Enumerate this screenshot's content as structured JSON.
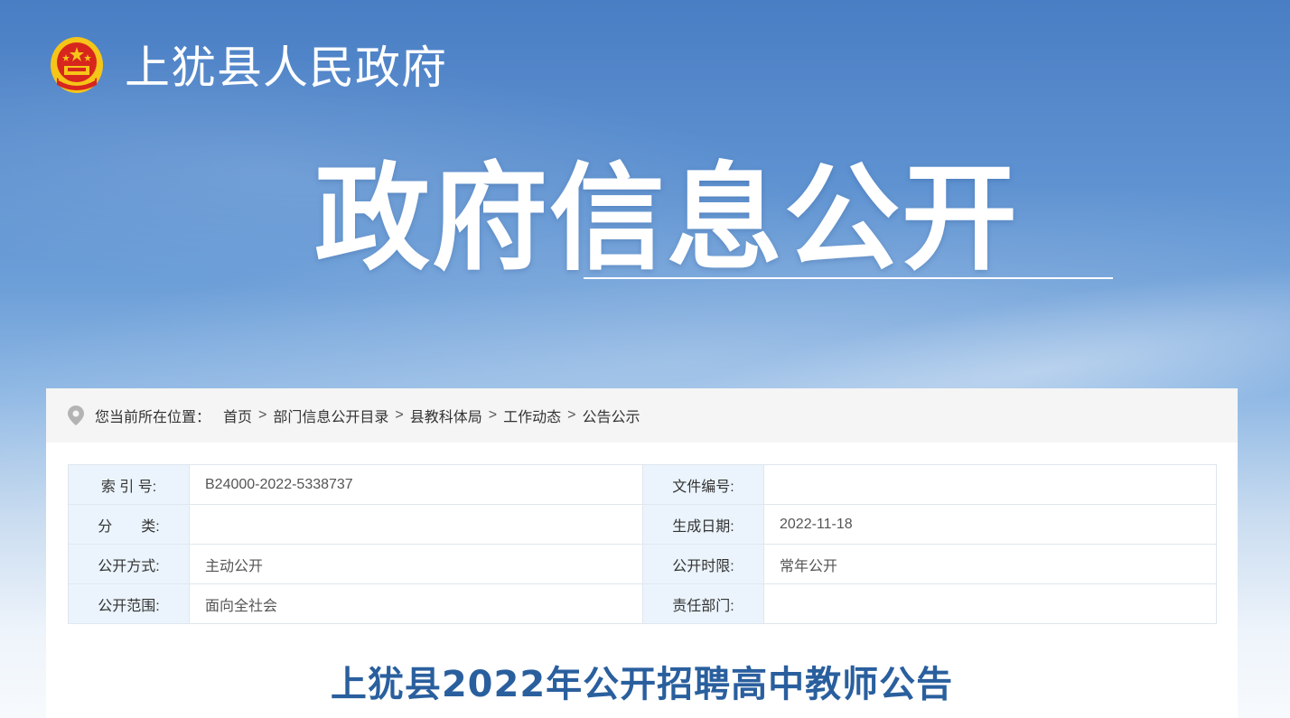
{
  "header": {
    "site_title": "上犹县人民政府",
    "logo_icon": "national-emblem-icon"
  },
  "banner": {
    "title": "政府信息公开"
  },
  "breadcrumb": {
    "icon": "location-pin-icon",
    "prefix": "您当前所在位置：",
    "items": [
      "首页",
      "部门信息公开目录",
      "县教科体局",
      "工作动态",
      "公告公示"
    ],
    "separator": ">"
  },
  "meta": {
    "rows": [
      {
        "label1": "索 引 号:",
        "value1": "B24000-2022-5338737",
        "label2": "文件编号:",
        "value2": ""
      },
      {
        "label1": "分　　类:",
        "value1": "",
        "label2": "生成日期:",
        "value2": "2022-11-18"
      },
      {
        "label1": "公开方式:",
        "value1": "主动公开",
        "label2": "公开时限:",
        "value2": "常年公开"
      },
      {
        "label1": "公开范围:",
        "value1": "面向全社会",
        "label2": "责任部门:",
        "value2": ""
      }
    ]
  },
  "article": {
    "title": "上犹县2022年公开招聘高中教师公告"
  },
  "colors": {
    "banner_blue": "#4a7ec4",
    "title_blue": "#2a5f9e",
    "label_bg": "#ebf4fc",
    "emblem_red": "#d7261e",
    "emblem_gold": "#f5c518"
  }
}
